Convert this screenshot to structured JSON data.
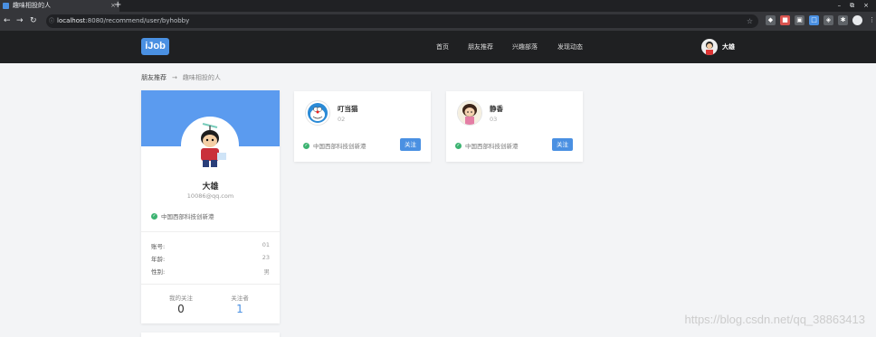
{
  "browser": {
    "tab_title": "趣味相投的人",
    "tab_close": "×",
    "new_tab": "+",
    "url_host": "localhost",
    "url_path": ":8080/recommend/user/byhobby",
    "window_controls": [
      "–",
      "⧉",
      "×"
    ]
  },
  "header": {
    "logo": "iJob",
    "menu": [
      "首页",
      "朋友推荐",
      "兴趣部落",
      "发现动态"
    ],
    "user_name": "大雄"
  },
  "breadcrumb": {
    "parent": "朋友推荐",
    "separator": "→",
    "current": "趣味相投的人"
  },
  "profile": {
    "name": "大雄",
    "email": "10086@qq.com",
    "org": "中国西部科技创新港",
    "fields": [
      {
        "label": "账号:",
        "value": "01"
      },
      {
        "label": "年龄:",
        "value": "23"
      },
      {
        "label": "性别:",
        "value": "男"
      }
    ],
    "stats": [
      {
        "label": "我的关注",
        "value": "0"
      },
      {
        "label": "关注者",
        "value": "1"
      }
    ]
  },
  "friends": [
    {
      "name": "叮当猫",
      "id": "02",
      "org": "中国西部科技创新港",
      "button": "关注"
    },
    {
      "name": "静香",
      "id": "03",
      "org": "中国西部科技创新港",
      "button": "关注"
    }
  ],
  "watermark": "https://blog.csdn.net/qq_38863413",
  "colors": {
    "accent": "#4a90e2",
    "header_bg": "#1f2022",
    "banner": "#5b9bef",
    "verified": "#3cb371"
  }
}
